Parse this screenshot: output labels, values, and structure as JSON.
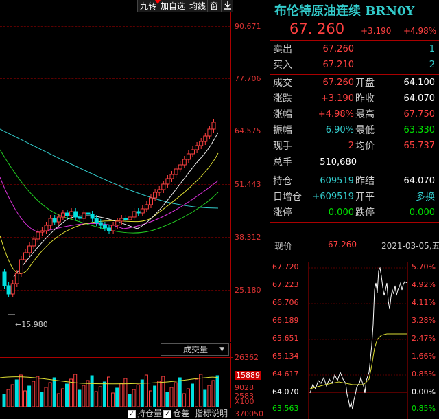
{
  "toolbar": {
    "items": [
      "九转",
      "加自选",
      "均线",
      "窗"
    ],
    "download_icon": "download-arrow-icon"
  },
  "main_chart": {
    "price_ticks": [
      "90.671",
      "77.706",
      "64.575",
      "51.443",
      "38.312",
      "25.180"
    ],
    "low_marker": "15.980"
  },
  "volume_chart": {
    "indicator_label": "成交量",
    "ticks": [
      "26362",
      "15889",
      "9028",
      "2583",
      "X100"
    ],
    "bottom_partial": "370050"
  },
  "bottom_bar": {
    "checkbox1": "持仓量",
    "checkbox2": "仓差",
    "link": "指标说明"
  },
  "quote": {
    "name": "布伦特原油连续",
    "code": "BRN0Y",
    "price": "67. 260",
    "change": "+3.190",
    "change_pct": "+4.98%"
  },
  "order_book": {
    "ask_label": "卖出",
    "ask_price": "67.260",
    "ask_vol": "1",
    "bid_label": "买入",
    "bid_price": "67.210",
    "bid_vol": "2"
  },
  "stats": [
    {
      "l1": "成交",
      "v1": "67.260",
      "l2": "开盘",
      "v2": "64.100"
    },
    {
      "l1": "涨跌",
      "v1": "+3.190",
      "l2": "昨收",
      "v2": "64.070"
    },
    {
      "l1": "涨幅",
      "v1": "+4.98%",
      "l2": "最高",
      "v2": "67.750"
    },
    {
      "l1": "振幅",
      "v1": "6.90%",
      "l2": "最低",
      "v2": "63.330"
    },
    {
      "l1": "现手",
      "v1": "2",
      "l2": "均价",
      "v2": "65.737"
    }
  ],
  "total": {
    "label": "总手",
    "value": "510,680"
  },
  "position": [
    {
      "l1": "持仓",
      "v1": "609519",
      "l2": "昨结",
      "v2": "64.070"
    },
    {
      "l1": "日增仓",
      "v1": "+609519",
      "l2": "开平",
      "v2": "多换"
    },
    {
      "l1": "涨停",
      "v1": "0.000",
      "l2": "跌停",
      "v2": "0.000"
    }
  ],
  "intraday": {
    "label": "现价",
    "price": "67.260",
    "date": "2021-03-05,五",
    "left_ticks": [
      "67.720",
      "67.223",
      "66.706",
      "66.189",
      "65.651",
      "65.134",
      "64.617",
      "64.070",
      "63.563"
    ],
    "right_ticks": [
      "5.70%",
      "4.92%",
      "4.11%",
      "3.28%",
      "2.47%",
      "1.66%",
      "0.85%",
      "0.00%",
      "0.85%"
    ]
  },
  "colors": {
    "up": "#ff4040",
    "down": "#00e0e0",
    "accent": "#3cc",
    "grid": "#5a0000"
  }
}
